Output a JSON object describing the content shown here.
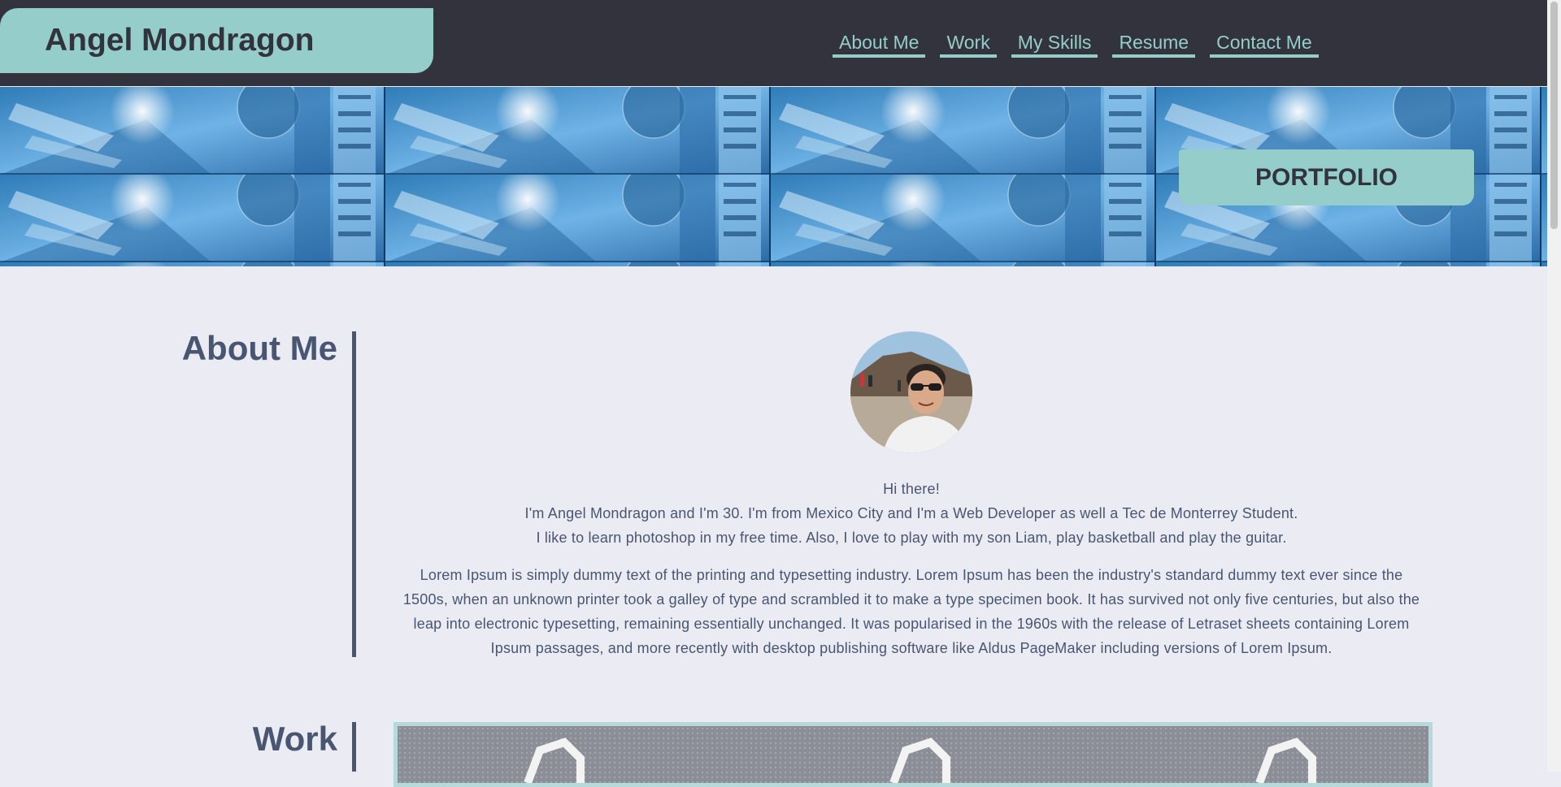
{
  "header": {
    "brand_name": "Angel Mondragon",
    "nav": [
      "About Me",
      "Work",
      "My Skills",
      "Resume",
      "Contact Me"
    ]
  },
  "banner": {
    "badge": "PORTFOLIO"
  },
  "about": {
    "title": "About Me",
    "intro": [
      "Hi there!",
      "I'm Angel Mondragon and I'm 30. I'm from Mexico City and I'm a Web Developer as well a Tec de Monterrey Student.",
      "I like to learn photoshop in my free time. Also, I love to play with my son Liam, play basketball and play the guitar."
    ],
    "lorem": "Lorem Ipsum is simply dummy text of the printing and typesetting industry. Lorem Ipsum has been the industry's standard dummy text ever since the 1500s, when an unknown printer took a galley of type and scrambled it to make a type specimen book. It has survived not only five centuries, but also the leap into electronic typesetting, remaining essentially unchanged. It was popularised in the 1960s with the release of Letraset sheets containing Lorem Ipsum passages, and more recently with desktop publishing software like Aldus PageMaker including versions of Lorem Ipsum."
  },
  "work": {
    "title": "Work"
  },
  "colors": {
    "header_bg": "#32333d",
    "accent": "#95cdcb",
    "page_bg": "#ebebf3",
    "heading": "#495671"
  }
}
